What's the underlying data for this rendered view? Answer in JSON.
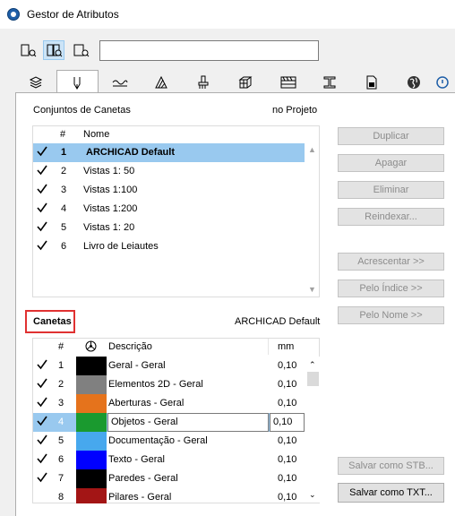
{
  "window": {
    "title": "Gestor de Atributos"
  },
  "toolbar": {
    "view_buttons": [
      "list-view-icon",
      "side-by-side-view-icon",
      "single-view-icon"
    ],
    "search": {
      "value": "",
      "placeholder": ""
    }
  },
  "tabs": [
    {
      "icon": "layers-icon"
    },
    {
      "icon": "pen-icon",
      "active": true
    },
    {
      "icon": "line-types-icon"
    },
    {
      "icon": "fill-types-icon"
    },
    {
      "icon": "surfaces-icon"
    },
    {
      "icon": "building-materials-icon"
    },
    {
      "icon": "composites-icon"
    },
    {
      "icon": "profiles-icon"
    },
    {
      "icon": "zone-categories-icon"
    },
    {
      "icon": "globe-icon"
    },
    {
      "icon": "more-tabs-icon"
    }
  ],
  "pensets": {
    "label": "Conjuntos de Canetas",
    "scope_label": "no Projeto",
    "col_num": "#",
    "col_name": "Nome",
    "rows": [
      {
        "num": "1",
        "name": "ARCHICAD Default",
        "checked": true,
        "selected": true
      },
      {
        "num": "2",
        "name": "Vistas 1: 50",
        "checked": true
      },
      {
        "num": "3",
        "name": "Vistas 1:100",
        "checked": true
      },
      {
        "num": "4",
        "name": "Vistas 1:200",
        "checked": true
      },
      {
        "num": "5",
        "name": "Vistas 1: 20",
        "checked": true
      },
      {
        "num": "6",
        "name": "Livro de Leiautes",
        "checked": true
      }
    ]
  },
  "pens": {
    "label": "Canetas",
    "current_set": "ARCHICAD Default",
    "col_num": "#",
    "col_color_icon": "color-wheel-icon",
    "col_desc": "Descrição",
    "col_mm": "mm",
    "rows": [
      {
        "num": "1",
        "color": "#000000",
        "desc": "Geral - Geral",
        "mm": "0,10",
        "checked": true
      },
      {
        "num": "2",
        "color": "#808080",
        "desc": "Elementos 2D - Geral",
        "mm": "0,10",
        "checked": true
      },
      {
        "num": "3",
        "color": "#e5731c",
        "desc": "Aberturas - Geral",
        "mm": "0,10",
        "checked": true
      },
      {
        "num": "4",
        "color": "#1a9a2f",
        "desc": "Objetos - Geral",
        "mm": "0,10",
        "checked": true,
        "selected": true
      },
      {
        "num": "5",
        "color": "#47a8ee",
        "desc": "Documentação - Geral",
        "mm": "0,10",
        "checked": true
      },
      {
        "num": "6",
        "color": "#0000ff",
        "desc": "Texto - Geral",
        "mm": "0,10",
        "checked": true
      },
      {
        "num": "7",
        "color": "#000000",
        "desc": "Paredes - Geral",
        "mm": "0,10",
        "checked": true
      },
      {
        "num": "8",
        "color": "#a31515",
        "desc": "Pilares - Geral",
        "mm": "0,10",
        "checked": false
      }
    ]
  },
  "buttons": {
    "duplicar": "Duplicar",
    "apagar": "Apagar",
    "eliminar": "Eliminar",
    "reindexar": "Reindexar...",
    "acrescentar": "Acrescentar >>",
    "pelo_indice": "Pelo Índice >>",
    "pelo_nome": "Pelo Nome >>",
    "salvar_stb": "Salvar como STB...",
    "salvar_txt": "Salvar como TXT..."
  }
}
